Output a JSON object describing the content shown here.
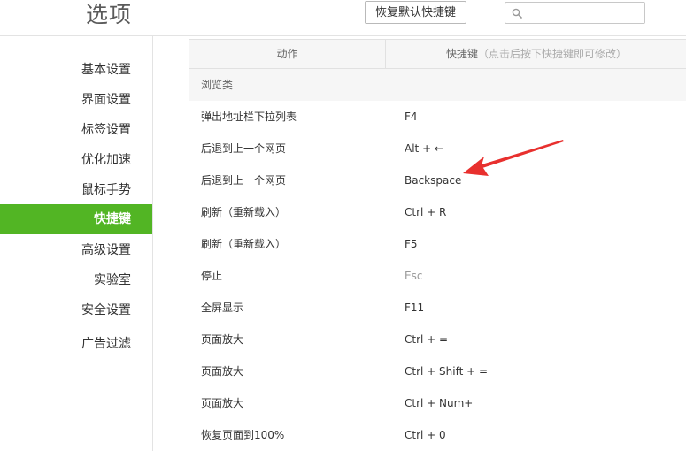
{
  "header": {
    "title": "选项",
    "restore_button": "恢复默认快捷键",
    "search_placeholder": ""
  },
  "sidebar": {
    "items": [
      {
        "label": "基本设置",
        "active": false
      },
      {
        "label": "界面设置",
        "active": false
      },
      {
        "label": "标签设置",
        "active": false
      },
      {
        "label": "优化加速",
        "active": false
      },
      {
        "label": "鼠标手势",
        "active": false
      },
      {
        "label": "快捷键",
        "active": true
      },
      {
        "label": "高级设置",
        "active": false
      },
      {
        "label": "实验室",
        "active": false
      },
      {
        "label": "安全设置",
        "active": false
      },
      {
        "label": "广告过滤",
        "active": false
      }
    ]
  },
  "table": {
    "headers": {
      "action": "动作",
      "shortcut": "快捷键",
      "shortcut_hint": "（点击后按下快捷键即可修改）"
    },
    "category": "浏览类",
    "rows": [
      {
        "action": "弹出地址栏下拉列表",
        "key": "F4",
        "muted": false
      },
      {
        "action": "后退到上一个网页",
        "key": "Alt + ←",
        "muted": false
      },
      {
        "action": "后退到上一个网页",
        "key": "Backspace",
        "muted": false
      },
      {
        "action": "刷新（重新载入）",
        "key": "Ctrl + R",
        "muted": false
      },
      {
        "action": "刷新（重新载入）",
        "key": "F5",
        "muted": false
      },
      {
        "action": "停止",
        "key": "Esc",
        "muted": true
      },
      {
        "action": "全屏显示",
        "key": "F11",
        "muted": false
      },
      {
        "action": "页面放大",
        "key": "Ctrl + =",
        "muted": false
      },
      {
        "action": "页面放大",
        "key": "Ctrl + Shift + =",
        "muted": false
      },
      {
        "action": "页面放大",
        "key": "Ctrl + Num+",
        "muted": false
      },
      {
        "action": "恢复页面到100%",
        "key": "Ctrl + 0",
        "muted": false
      }
    ]
  },
  "colors": {
    "accent_green": "#52b524",
    "annotation_arrow": "#e8302e"
  },
  "icons": {
    "search": "search-icon",
    "annotation": "annotation-arrow-icon"
  }
}
